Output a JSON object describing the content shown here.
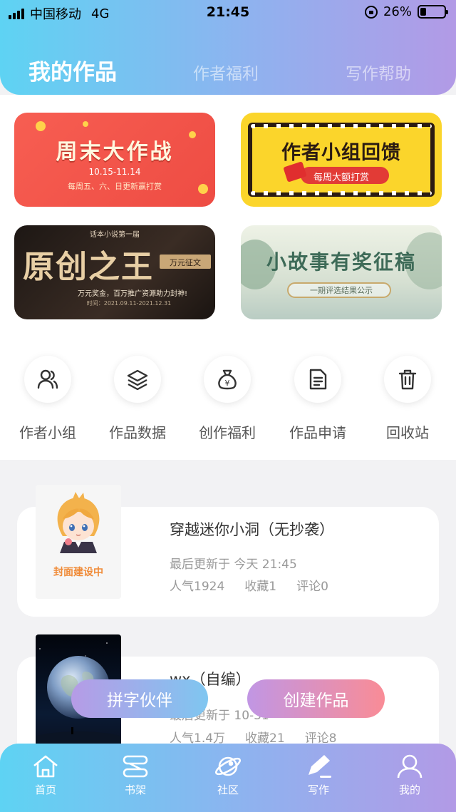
{
  "status_bar": {
    "carrier": "中国移动",
    "network": "4G",
    "time": "21:45",
    "battery": "26%",
    "battery_level": 0.26
  },
  "header": {
    "tabs": [
      {
        "label": "我的作品",
        "active": true
      },
      {
        "label": "作者福利",
        "active": false
      },
      {
        "label": "写作帮助",
        "active": false
      }
    ]
  },
  "banners": [
    {
      "title": "周末大作战",
      "date": "10.15-11.14",
      "subtitle": "每周五、六、日更新赢打赏"
    },
    {
      "title": "作者小组回馈",
      "subtitle": "每周大额打赏"
    },
    {
      "kicker": "话本小说第一届",
      "title": "原创之王",
      "tag": "万元征文",
      "subtitle": "万元奖金，百万推广资源助力封神!",
      "date": "时间：2021.09.11-2021.12.31"
    },
    {
      "title": "小故事有奖征稿",
      "subtitle": "一期评选结果公示"
    }
  ],
  "actions": [
    {
      "label": "作者小组",
      "icon": "group-icon"
    },
    {
      "label": "作品数据",
      "icon": "layers-icon"
    },
    {
      "label": "创作福利",
      "icon": "money-bag-icon"
    },
    {
      "label": "作品申请",
      "icon": "document-icon"
    },
    {
      "label": "回收站",
      "icon": "trash-icon"
    }
  ],
  "works": [
    {
      "title": "穿越迷你小洞（无抄袭）",
      "updated": "最后更新于 今天 21:45",
      "popularity": "人气1924",
      "favorites": "收藏1",
      "comments": "评论0",
      "cover_caption": "封面建设中"
    },
    {
      "title": "wx（自编）",
      "updated": "最后更新于 10-31",
      "popularity": "人气1.4万",
      "favorites": "收藏21",
      "comments": "评论8"
    }
  ],
  "floating_buttons": {
    "partner": "拼字伙伴",
    "create": "创建作品"
  },
  "bottom_nav": [
    {
      "label": "首页",
      "icon": "home-icon"
    },
    {
      "label": "书架",
      "icon": "bookshelf-icon"
    },
    {
      "label": "社区",
      "icon": "planet-icon"
    },
    {
      "label": "写作",
      "icon": "pen-icon"
    },
    {
      "label": "我的",
      "icon": "user-icon"
    }
  ]
}
